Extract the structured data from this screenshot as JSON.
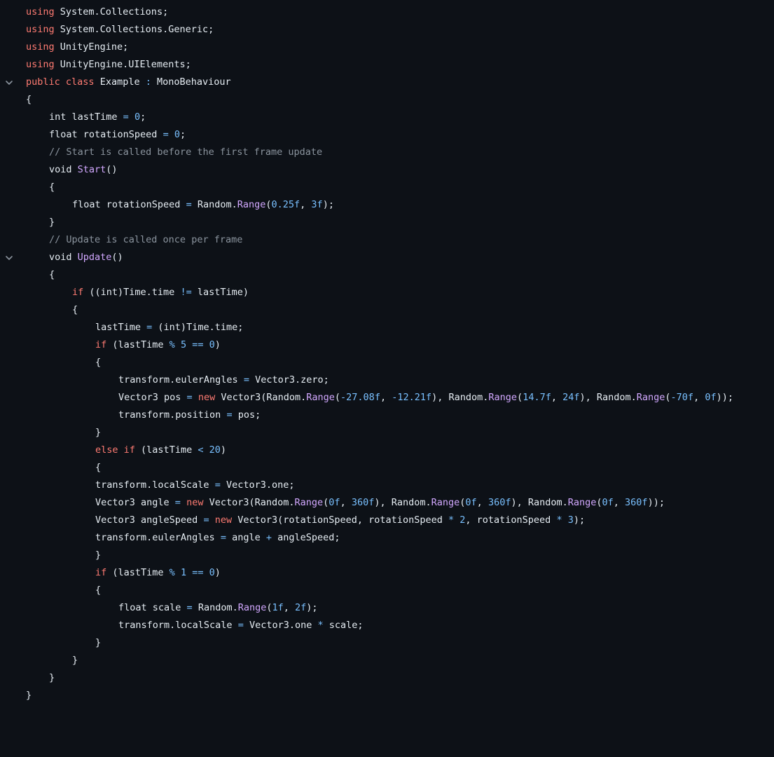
{
  "editor": {
    "fold_icon": "chevron-down-icon",
    "colors": {
      "background": "#0d1117",
      "text": "#e6edf3",
      "keyword": "#ff7b72",
      "function": "#d2a8ff",
      "number": "#79c0ff",
      "operator": "#79c0ff",
      "comment": "#8b949e"
    },
    "lines": [
      {
        "indent": 0,
        "fold": false,
        "tokens": [
          {
            "t": "kw",
            "v": "using"
          },
          {
            "t": "pl",
            "v": " System.Collections;"
          }
        ]
      },
      {
        "indent": 0,
        "fold": false,
        "tokens": [
          {
            "t": "kw",
            "v": "using"
          },
          {
            "t": "pl",
            "v": " System.Collections.Generic;"
          }
        ]
      },
      {
        "indent": 0,
        "fold": false,
        "tokens": [
          {
            "t": "kw",
            "v": "using"
          },
          {
            "t": "pl",
            "v": " UnityEngine;"
          }
        ]
      },
      {
        "indent": 0,
        "fold": false,
        "tokens": [
          {
            "t": "kw",
            "v": "using"
          },
          {
            "t": "pl",
            "v": " UnityEngine.UIElements;"
          }
        ]
      },
      {
        "indent": 0,
        "fold": true,
        "tokens": [
          {
            "t": "kw",
            "v": "public"
          },
          {
            "t": "pl",
            "v": " "
          },
          {
            "t": "kw",
            "v": "class"
          },
          {
            "t": "pl",
            "v": " Example "
          },
          {
            "t": "op",
            "v": ":"
          },
          {
            "t": "pl",
            "v": " MonoBehaviour"
          }
        ]
      },
      {
        "indent": 0,
        "fold": false,
        "tokens": [
          {
            "t": "pl",
            "v": "{"
          }
        ]
      },
      {
        "indent": 1,
        "fold": false,
        "tokens": [
          {
            "t": "pl",
            "v": "int lastTime "
          },
          {
            "t": "op",
            "v": "="
          },
          {
            "t": "pl",
            "v": " "
          },
          {
            "t": "num",
            "v": "0"
          },
          {
            "t": "pl",
            "v": ";"
          }
        ]
      },
      {
        "indent": 1,
        "fold": false,
        "tokens": [
          {
            "t": "pl",
            "v": "float rotationSpeed "
          },
          {
            "t": "op",
            "v": "="
          },
          {
            "t": "pl",
            "v": " "
          },
          {
            "t": "num",
            "v": "0"
          },
          {
            "t": "pl",
            "v": ";"
          }
        ]
      },
      {
        "indent": 1,
        "fold": false,
        "tokens": [
          {
            "t": "cm",
            "v": "// Start is called before the first frame update"
          }
        ]
      },
      {
        "indent": 1,
        "fold": false,
        "tokens": [
          {
            "t": "pl",
            "v": "void "
          },
          {
            "t": "fn",
            "v": "Start"
          },
          {
            "t": "pl",
            "v": "()"
          }
        ]
      },
      {
        "indent": 1,
        "fold": false,
        "tokens": [
          {
            "t": "pl",
            "v": "{"
          }
        ]
      },
      {
        "indent": 2,
        "fold": false,
        "tokens": [
          {
            "t": "pl",
            "v": "float rotationSpeed "
          },
          {
            "t": "op",
            "v": "="
          },
          {
            "t": "pl",
            "v": " Random."
          },
          {
            "t": "fn",
            "v": "Range"
          },
          {
            "t": "pl",
            "v": "("
          },
          {
            "t": "num",
            "v": "0.25f"
          },
          {
            "t": "pl",
            "v": ", "
          },
          {
            "t": "num",
            "v": "3f"
          },
          {
            "t": "pl",
            "v": ");"
          }
        ]
      },
      {
        "indent": 1,
        "fold": false,
        "tokens": [
          {
            "t": "pl",
            "v": "}"
          }
        ]
      },
      {
        "indent": 1,
        "fold": false,
        "tokens": [
          {
            "t": "cm",
            "v": "// Update is called once per frame"
          }
        ]
      },
      {
        "indent": 1,
        "fold": true,
        "tokens": [
          {
            "t": "pl",
            "v": "void "
          },
          {
            "t": "fn",
            "v": "Update"
          },
          {
            "t": "pl",
            "v": "()"
          }
        ]
      },
      {
        "indent": 1,
        "fold": false,
        "tokens": [
          {
            "t": "pl",
            "v": "{"
          }
        ]
      },
      {
        "indent": 2,
        "fold": false,
        "tokens": [
          {
            "t": "kw",
            "v": "if"
          },
          {
            "t": "pl",
            "v": " ((int)Time.time "
          },
          {
            "t": "op",
            "v": "!="
          },
          {
            "t": "pl",
            "v": " lastTime)"
          }
        ]
      },
      {
        "indent": 2,
        "fold": false,
        "tokens": [
          {
            "t": "pl",
            "v": "{"
          }
        ]
      },
      {
        "indent": 3,
        "fold": false,
        "tokens": [
          {
            "t": "pl",
            "v": "lastTime "
          },
          {
            "t": "op",
            "v": "="
          },
          {
            "t": "pl",
            "v": " (int)Time.time;"
          }
        ]
      },
      {
        "indent": 3,
        "fold": false,
        "tokens": [
          {
            "t": "kw",
            "v": "if"
          },
          {
            "t": "pl",
            "v": " (lastTime "
          },
          {
            "t": "op",
            "v": "%"
          },
          {
            "t": "pl",
            "v": " "
          },
          {
            "t": "num",
            "v": "5"
          },
          {
            "t": "pl",
            "v": " "
          },
          {
            "t": "op",
            "v": "=="
          },
          {
            "t": "pl",
            "v": " "
          },
          {
            "t": "num",
            "v": "0"
          },
          {
            "t": "pl",
            "v": ")"
          }
        ]
      },
      {
        "indent": 3,
        "fold": false,
        "tokens": [
          {
            "t": "pl",
            "v": "{"
          }
        ]
      },
      {
        "indent": 4,
        "fold": false,
        "tokens": [
          {
            "t": "pl",
            "v": "transform.eulerAngles "
          },
          {
            "t": "op",
            "v": "="
          },
          {
            "t": "pl",
            "v": " Vector3.zero;"
          }
        ]
      },
      {
        "indent": 4,
        "fold": false,
        "tokens": [
          {
            "t": "pl",
            "v": "Vector3 pos "
          },
          {
            "t": "op",
            "v": "="
          },
          {
            "t": "pl",
            "v": " "
          },
          {
            "t": "kw",
            "v": "new"
          },
          {
            "t": "pl",
            "v": " Vector3(Random."
          },
          {
            "t": "fn",
            "v": "Range"
          },
          {
            "t": "pl",
            "v": "("
          },
          {
            "t": "num",
            "v": "-27.08f"
          },
          {
            "t": "pl",
            "v": ", "
          },
          {
            "t": "num",
            "v": "-12.21f"
          },
          {
            "t": "pl",
            "v": "), Random."
          },
          {
            "t": "fn",
            "v": "Range"
          },
          {
            "t": "pl",
            "v": "("
          },
          {
            "t": "num",
            "v": "14.7f"
          },
          {
            "t": "pl",
            "v": ", "
          },
          {
            "t": "num",
            "v": "24f"
          },
          {
            "t": "pl",
            "v": "), Random."
          },
          {
            "t": "fn",
            "v": "Range"
          },
          {
            "t": "pl",
            "v": "("
          },
          {
            "t": "num",
            "v": "-70f"
          },
          {
            "t": "pl",
            "v": ", "
          },
          {
            "t": "num",
            "v": "0f"
          },
          {
            "t": "pl",
            "v": "));"
          }
        ]
      },
      {
        "indent": 4,
        "fold": false,
        "tokens": [
          {
            "t": "pl",
            "v": "transform.position "
          },
          {
            "t": "op",
            "v": "="
          },
          {
            "t": "pl",
            "v": " pos;"
          }
        ]
      },
      {
        "indent": 3,
        "fold": false,
        "tokens": [
          {
            "t": "pl",
            "v": "}"
          }
        ]
      },
      {
        "indent": 3,
        "fold": false,
        "tokens": [
          {
            "t": "kw",
            "v": "else"
          },
          {
            "t": "pl",
            "v": " "
          },
          {
            "t": "kw",
            "v": "if"
          },
          {
            "t": "pl",
            "v": " (lastTime "
          },
          {
            "t": "op",
            "v": "<"
          },
          {
            "t": "pl",
            "v": " "
          },
          {
            "t": "num",
            "v": "20"
          },
          {
            "t": "pl",
            "v": ")"
          }
        ]
      },
      {
        "indent": 3,
        "fold": false,
        "tokens": [
          {
            "t": "pl",
            "v": "{"
          }
        ]
      },
      {
        "indent": 3,
        "fold": false,
        "tokens": [
          {
            "t": "pl",
            "v": "transform.localScale "
          },
          {
            "t": "op",
            "v": "="
          },
          {
            "t": "pl",
            "v": " Vector3.one;"
          }
        ]
      },
      {
        "indent": 3,
        "fold": false,
        "tokens": [
          {
            "t": "pl",
            "v": "Vector3 angle "
          },
          {
            "t": "op",
            "v": "="
          },
          {
            "t": "pl",
            "v": " "
          },
          {
            "t": "kw",
            "v": "new"
          },
          {
            "t": "pl",
            "v": " Vector3(Random."
          },
          {
            "t": "fn",
            "v": "Range"
          },
          {
            "t": "pl",
            "v": "("
          },
          {
            "t": "num",
            "v": "0f"
          },
          {
            "t": "pl",
            "v": ", "
          },
          {
            "t": "num",
            "v": "360f"
          },
          {
            "t": "pl",
            "v": "), Random."
          },
          {
            "t": "fn",
            "v": "Range"
          },
          {
            "t": "pl",
            "v": "("
          },
          {
            "t": "num",
            "v": "0f"
          },
          {
            "t": "pl",
            "v": ", "
          },
          {
            "t": "num",
            "v": "360f"
          },
          {
            "t": "pl",
            "v": "), Random."
          },
          {
            "t": "fn",
            "v": "Range"
          },
          {
            "t": "pl",
            "v": "("
          },
          {
            "t": "num",
            "v": "0f"
          },
          {
            "t": "pl",
            "v": ", "
          },
          {
            "t": "num",
            "v": "360f"
          },
          {
            "t": "pl",
            "v": "));"
          }
        ]
      },
      {
        "indent": 3,
        "fold": false,
        "tokens": [
          {
            "t": "pl",
            "v": "Vector3 angleSpeed "
          },
          {
            "t": "op",
            "v": "="
          },
          {
            "t": "pl",
            "v": " "
          },
          {
            "t": "kw",
            "v": "new"
          },
          {
            "t": "pl",
            "v": " Vector3(rotationSpeed, rotationSpeed "
          },
          {
            "t": "op",
            "v": "*"
          },
          {
            "t": "pl",
            "v": " "
          },
          {
            "t": "num",
            "v": "2"
          },
          {
            "t": "pl",
            "v": ", rotationSpeed "
          },
          {
            "t": "op",
            "v": "*"
          },
          {
            "t": "pl",
            "v": " "
          },
          {
            "t": "num",
            "v": "3"
          },
          {
            "t": "pl",
            "v": ");"
          }
        ]
      },
      {
        "indent": 3,
        "fold": false,
        "tokens": [
          {
            "t": "pl",
            "v": "transform.eulerAngles "
          },
          {
            "t": "op",
            "v": "="
          },
          {
            "t": "pl",
            "v": " angle "
          },
          {
            "t": "op",
            "v": "+"
          },
          {
            "t": "pl",
            "v": " angleSpeed;"
          }
        ]
      },
      {
        "indent": 3,
        "fold": false,
        "tokens": [
          {
            "t": "pl",
            "v": "}"
          }
        ]
      },
      {
        "indent": 3,
        "fold": false,
        "tokens": [
          {
            "t": "kw",
            "v": "if"
          },
          {
            "t": "pl",
            "v": " (lastTime "
          },
          {
            "t": "op",
            "v": "%"
          },
          {
            "t": "pl",
            "v": " "
          },
          {
            "t": "num",
            "v": "1"
          },
          {
            "t": "pl",
            "v": " "
          },
          {
            "t": "op",
            "v": "=="
          },
          {
            "t": "pl",
            "v": " "
          },
          {
            "t": "num",
            "v": "0"
          },
          {
            "t": "pl",
            "v": ")"
          }
        ]
      },
      {
        "indent": 3,
        "fold": false,
        "tokens": [
          {
            "t": "pl",
            "v": "{"
          }
        ]
      },
      {
        "indent": 4,
        "fold": false,
        "tokens": [
          {
            "t": "pl",
            "v": "float scale "
          },
          {
            "t": "op",
            "v": "="
          },
          {
            "t": "pl",
            "v": " Random."
          },
          {
            "t": "fn",
            "v": "Range"
          },
          {
            "t": "pl",
            "v": "("
          },
          {
            "t": "num",
            "v": "1f"
          },
          {
            "t": "pl",
            "v": ", "
          },
          {
            "t": "num",
            "v": "2f"
          },
          {
            "t": "pl",
            "v": ");"
          }
        ]
      },
      {
        "indent": 4,
        "fold": false,
        "tokens": [
          {
            "t": "pl",
            "v": "transform.localScale "
          },
          {
            "t": "op",
            "v": "="
          },
          {
            "t": "pl",
            "v": " Vector3.one "
          },
          {
            "t": "op",
            "v": "*"
          },
          {
            "t": "pl",
            "v": " scale;"
          }
        ]
      },
      {
        "indent": 3,
        "fold": false,
        "tokens": [
          {
            "t": "pl",
            "v": "}"
          }
        ]
      },
      {
        "indent": 2,
        "fold": false,
        "tokens": [
          {
            "t": "pl",
            "v": "}"
          }
        ]
      },
      {
        "indent": 1,
        "fold": false,
        "tokens": [
          {
            "t": "pl",
            "v": "}"
          }
        ]
      },
      {
        "indent": 0,
        "fold": false,
        "tokens": [
          {
            "t": "pl",
            "v": "}"
          }
        ]
      }
    ]
  }
}
